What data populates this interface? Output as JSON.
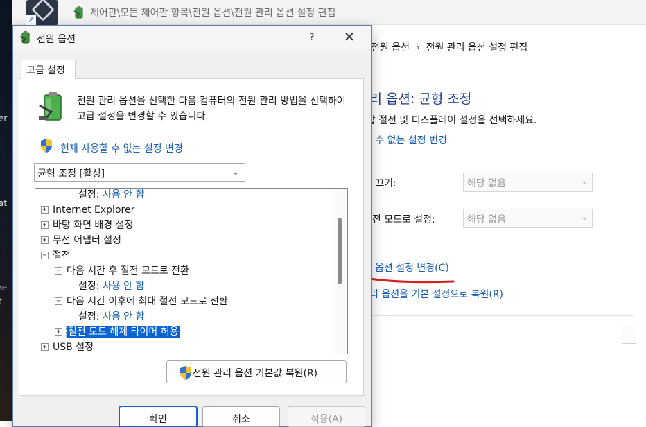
{
  "desktop": {
    "fragments": [
      "er",
      "at",
      "re",
      "t"
    ]
  },
  "control_panel": {
    "title": "제어판\\모든 제어판 항목\\전원 옵션\\전원 관리 옵션 설정 편집",
    "breadcrumb": [
      "전원 옵션",
      "전원 관리 옵션 설정 편집"
    ],
    "heading": "관리 옵션: 균형 조정",
    "subtitle": "용할 절전 및 디스플레이 설정을 선택하세요.",
    "unavailable_link": "할 수 없는 설정 변경",
    "display_off_label": "이 끄기:",
    "display_off_value": "해당 없음",
    "sleep_label": "절전 모드로 설정:",
    "sleep_value": "해당 없음",
    "advanced_link": "옵션 설정 변경(C)",
    "restore_link": "리 옵션을 기본 설정으로 복원(R)",
    "annotation_color": "#d42020"
  },
  "dialog": {
    "title": "전원 옵션",
    "help_label": "?",
    "close_label": "✕",
    "tab_label": "고급 설정",
    "description": "전원 관리 옵션을 선택한 다음 컴퓨터의 전원 관리 방법을 선택하여 고급 설정을 변경할 수 있습니다.",
    "unavailable_link": "현재 사용할 수 없는 설정 변경",
    "plan_selected": "균형 조정 [활성]",
    "tree": [
      {
        "label": "설정:",
        "value": "사용 안 함",
        "indent": 2,
        "box": ""
      },
      {
        "label": "Internet Explorer",
        "indent": 0,
        "box": "+"
      },
      {
        "label": "바탕 화면 배경 설정",
        "indent": 0,
        "box": "+"
      },
      {
        "label": "무선 어댑터 설정",
        "indent": 0,
        "box": "+"
      },
      {
        "label": "절전",
        "indent": 0,
        "box": "−"
      },
      {
        "label": "다음 시간 후 절전 모드로 전환",
        "indent": 1,
        "box": "−"
      },
      {
        "label": "설정:",
        "value": "사용 안 함",
        "indent": 2,
        "box": ""
      },
      {
        "label": "다음 시간 이후에 최대 절전 모드로 전환",
        "indent": 1,
        "box": "−"
      },
      {
        "label": "설정:",
        "value": "사용 안 함",
        "indent": 2,
        "box": ""
      },
      {
        "label": "절전 모드 해제 타이머 허용",
        "indent": 1,
        "box": "+",
        "selected": true
      },
      {
        "label": "USB 설정",
        "indent": 0,
        "box": "+"
      }
    ],
    "restore_button": "전원 관리 옵션 기본값 복원(R)",
    "ok_button": "확인",
    "cancel_button": "취소",
    "apply_button": "적용(A)",
    "selection_color": "#0a64d2",
    "link_color": "#1a5fb4"
  }
}
